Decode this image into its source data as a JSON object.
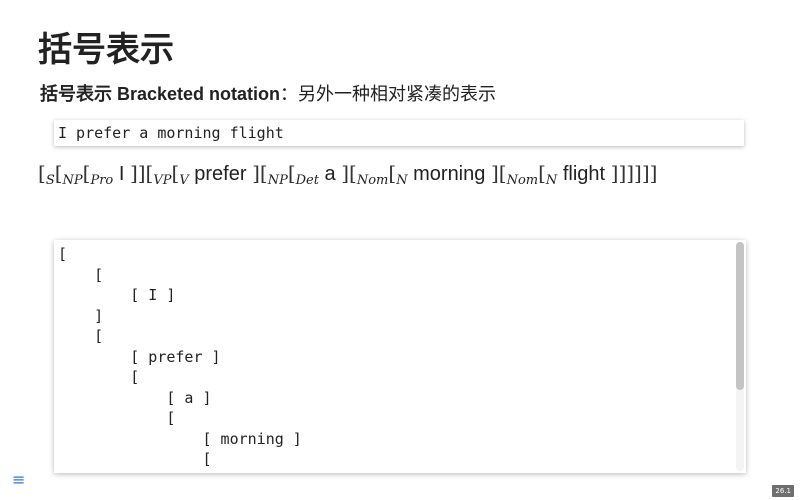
{
  "title": "括号表示",
  "subtitle": {
    "zh_label": "括号表示",
    "en_label": " Bracketed notation",
    "colon": "：",
    "description": "另外一种相对紧凑的表示"
  },
  "sentence": "I prefer a morning flight",
  "bracketed": {
    "b1": "[",
    "s": "S",
    "b2": "[",
    "np1": "NP",
    "b3": "[",
    "pro": "Pro",
    "w_i": " I ",
    "c1": "]]",
    "b4": "[",
    "vp": "VP",
    "b5": "[",
    "v": "V",
    "w_prefer": " prefer ",
    "c2": "]",
    "b6": "[",
    "np2": "NP",
    "b7": "[",
    "det": "Det",
    "w_a": " a ",
    "c3": "]",
    "b8": "[",
    "nom1": "Nom",
    "b9": "[",
    "n1": "N",
    "w_morning": " morning ",
    "c4": "]",
    "b10": "[",
    "nom2": "Nom",
    "b11": "[",
    "n2": "N",
    "w_flight": " flight ",
    "c5": "]]]]]]"
  },
  "tree_lines": [
    "[",
    "    [",
    "        [ I ]",
    "    ]",
    "    [",
    "        [ prefer ]",
    "        [",
    "            [ a ]",
    "            [",
    "                [ morning ]",
    "                ["
  ],
  "menu_icon": "hamburger-menu-icon",
  "slide_number": "26.1"
}
